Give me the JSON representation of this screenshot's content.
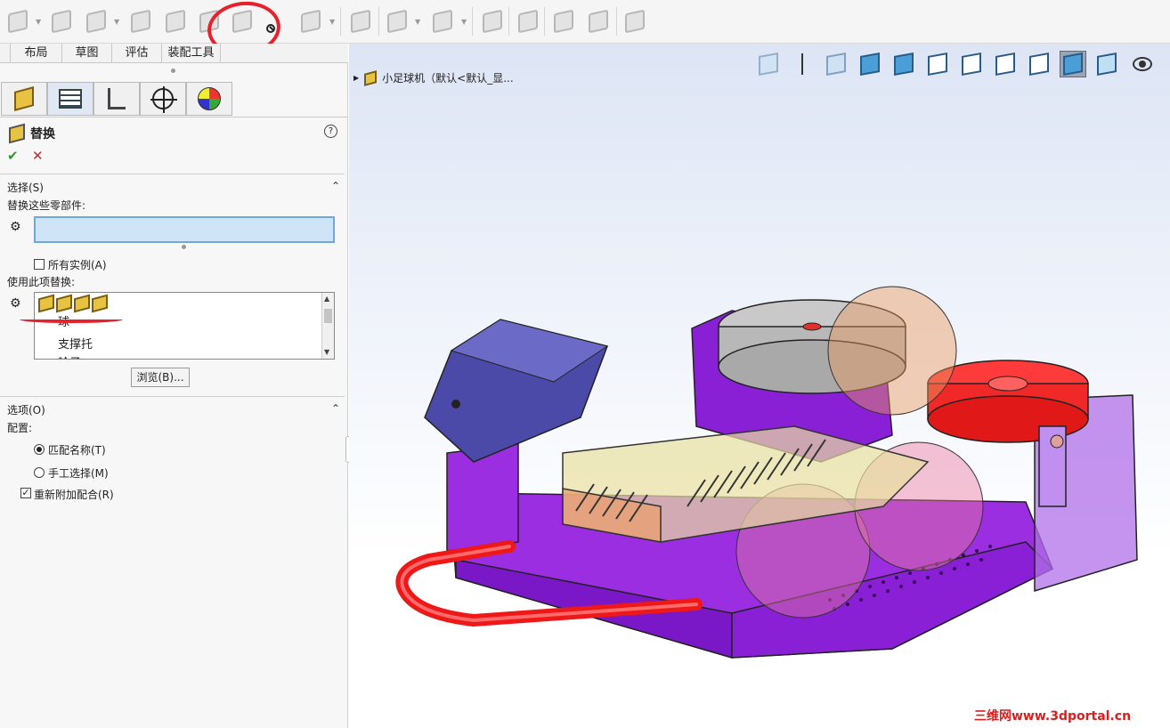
{
  "tabs": [
    "布局",
    "草图",
    "评估",
    "装配工具"
  ],
  "feature": {
    "title": "替换",
    "help": "?"
  },
  "selection": {
    "title": "选择(S)",
    "replace_label": "替换这些零部件:",
    "all_instances": "所有实例(A)",
    "replace_with_label": "使用此项替换:",
    "list_items": [
      "球",
      "支撑托",
      "轮子"
    ],
    "browse": "浏览(B)..."
  },
  "options": {
    "title": "选项(O)",
    "config_label": "配置:",
    "match_name": "匹配名称(T)",
    "manual_select": "手工选择(M)",
    "reattach": "重新附加配合(R)"
  },
  "tree": {
    "root": "小足球机（默认<默认_显..."
  },
  "watermark": "三维网www.3dportal.cn",
  "colors": {
    "accent": "#e8202a",
    "purple": "#8b1fd8"
  }
}
